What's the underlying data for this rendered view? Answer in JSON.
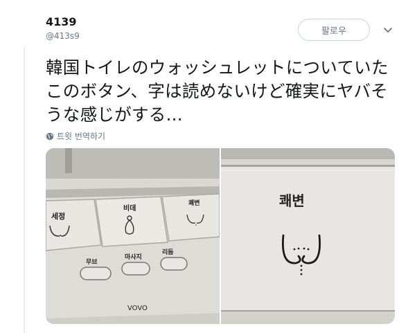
{
  "tweet": {
    "display_name": "4139",
    "handle": "@413s9",
    "follow_label": "팔로우",
    "text": "韓国トイレのウォッシュレットについていたこのボタン、字は読めないけど確実にヤバそうな感じがする...",
    "translate_label": "트윗 번역하기"
  },
  "photo_left": {
    "buttons": [
      "세정",
      "비데",
      "쾌변"
    ],
    "small_buttons": [
      "무브",
      "마사지",
      "리듬"
    ],
    "brand": "VOVO"
  },
  "photo_right": {
    "label": "쾌변"
  },
  "icons": [
    "chevron-down-icon",
    "globe-icon",
    "wash-icon",
    "bidet-icon",
    "bowel-icon"
  ]
}
